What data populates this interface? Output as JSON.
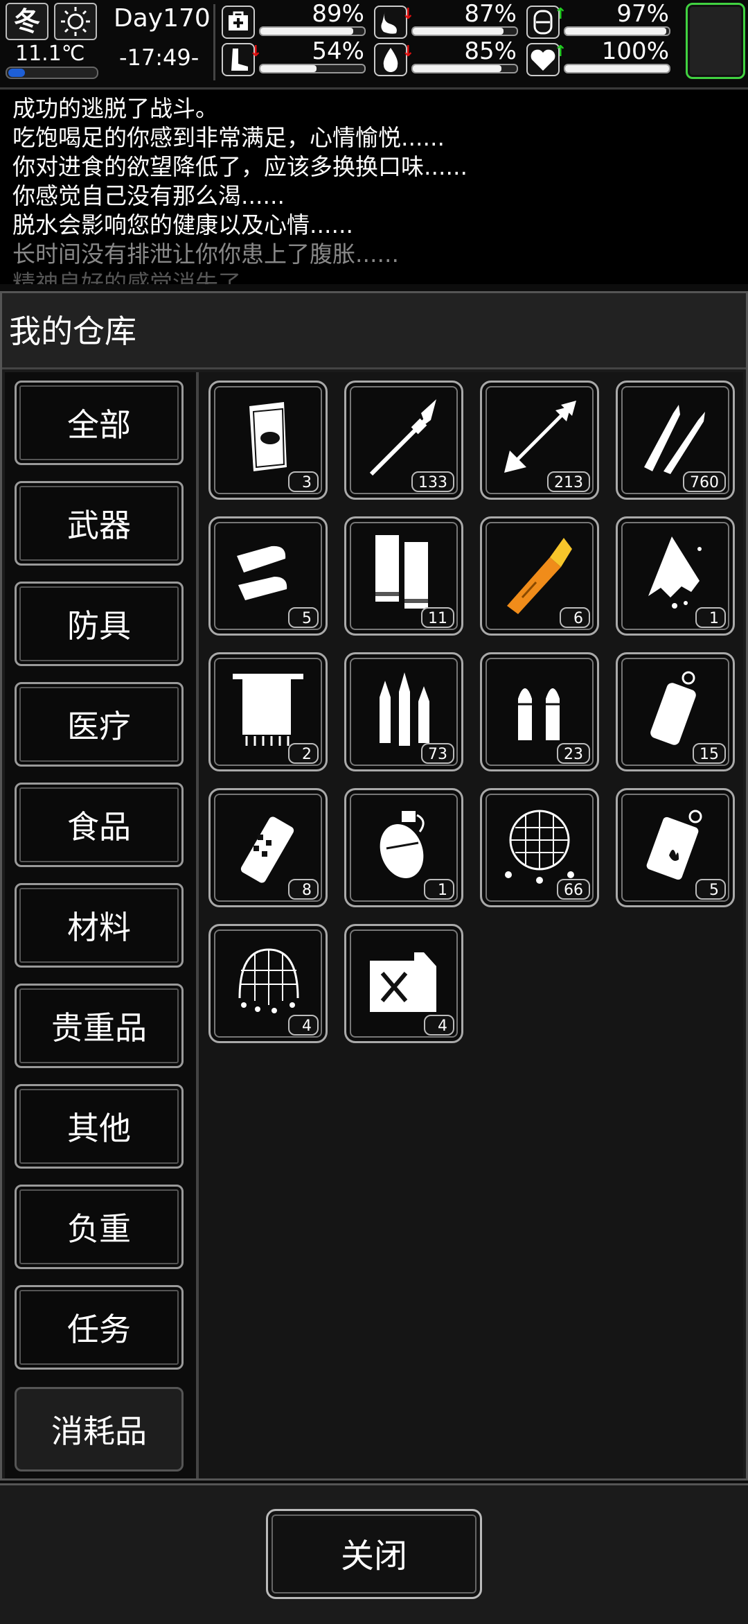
{
  "status": {
    "season": "冬",
    "weather_icon": "sun-icon",
    "temperature": "11.1℃",
    "day": "Day170",
    "time": "-17:49-",
    "stats": [
      {
        "name": "health",
        "icon": "medkit-icon",
        "value": "89%",
        "fraction": 0.89,
        "trend": ""
      },
      {
        "name": "hunger",
        "icon": "stomach-icon",
        "value": "87%",
        "fraction": 0.87,
        "trend": "down"
      },
      {
        "name": "mood",
        "icon": "mood-icon",
        "value": "97%",
        "fraction": 0.97,
        "trend": "up"
      },
      {
        "name": "stamina",
        "icon": "foot-icon",
        "value": "54%",
        "fraction": 0.54,
        "trend": "down"
      },
      {
        "name": "thirst",
        "icon": "water-drop-icon",
        "value": "85%",
        "fraction": 0.85,
        "trend": "down"
      },
      {
        "name": "spirit",
        "icon": "heart-icon",
        "value": "100%",
        "fraction": 1.0,
        "trend": "up"
      }
    ]
  },
  "log": [
    "成功的逃脱了战斗。",
    "吃饱喝足的你感到非常满足，心情愉悦......",
    "你对进食的欲望降低了，应该多换换口味......",
    "你感觉自己没有那么渴......",
    "脱水会影响您的健康以及心情......",
    "长时间没有排泄让你你患上了腹胀......",
    "精神良好的感觉消失了......"
  ],
  "warehouse": {
    "title": "我的仓库",
    "categories": [
      "全部",
      "武器",
      "防具",
      "医疗",
      "食品",
      "材料",
      "贵重品",
      "其他",
      "负重",
      "任务",
      "消耗品"
    ],
    "active_category": "消耗品",
    "items": [
      {
        "icon": "book-icon",
        "count": "3"
      },
      {
        "icon": "spear-icon",
        "count": "133"
      },
      {
        "icon": "arrow-icon",
        "count": "213"
      },
      {
        "icon": "rifle-bullets-icon",
        "count": "760"
      },
      {
        "icon": "shotgun-slugs-icon",
        "count": "5"
      },
      {
        "icon": "shotgun-shells-icon",
        "count": "11"
      },
      {
        "icon": "rocket-ammo-icon",
        "count": "6",
        "color": "#f08c1a"
      },
      {
        "icon": "torn-cloth-icon",
        "count": "1"
      },
      {
        "icon": "towel-icon",
        "count": "2"
      },
      {
        "icon": "rifle-rounds-icon",
        "count": "73"
      },
      {
        "icon": "pistol-rounds-icon",
        "count": "23"
      },
      {
        "icon": "grenade-canister-icon",
        "count": "15"
      },
      {
        "icon": "flashbang-icon",
        "count": "8"
      },
      {
        "icon": "frag-grenade-icon",
        "count": "1"
      },
      {
        "icon": "net-large-icon",
        "count": "66"
      },
      {
        "icon": "molotov-can-icon",
        "count": "5"
      },
      {
        "icon": "net-small-icon",
        "count": "4"
      },
      {
        "icon": "fuel-can-icon",
        "count": "4"
      }
    ]
  },
  "close_label": "关闭"
}
